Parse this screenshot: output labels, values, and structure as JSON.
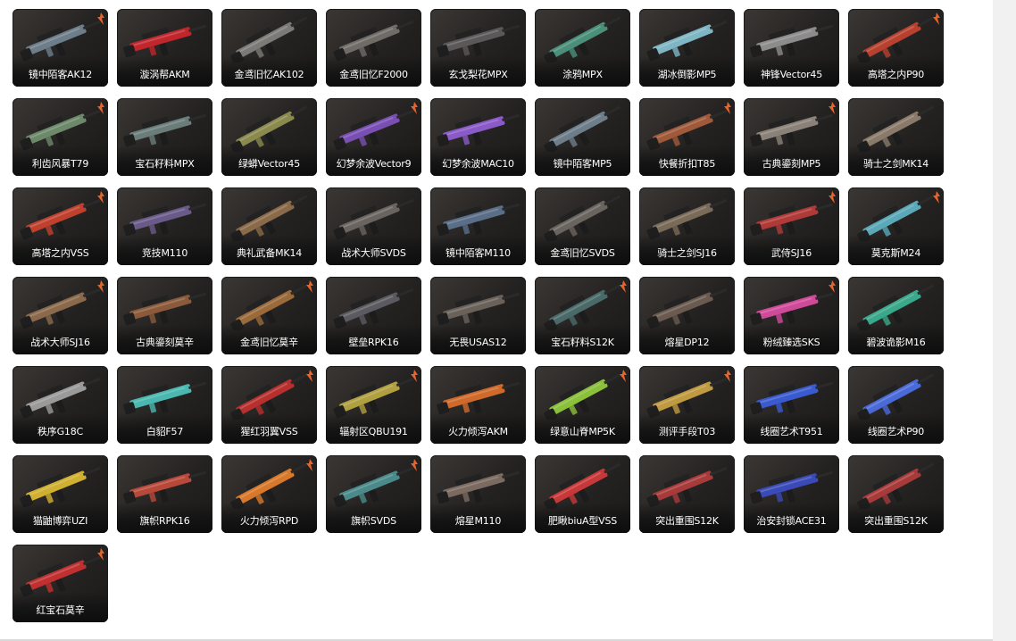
{
  "items": [
    {
      "name": "镜中陌客AK12",
      "accent": "#6d7e8a",
      "badge": true
    },
    {
      "name": "漩涡帮AKM",
      "accent": "#c0262c",
      "badge": false
    },
    {
      "name": "金鸢旧忆AK102",
      "accent": "#7c7a76",
      "badge": false
    },
    {
      "name": "金鸢旧忆F2000",
      "accent": "#6f6c68",
      "badge": false
    },
    {
      "name": "玄戈梨花MPX",
      "accent": "#5a5858",
      "badge": false
    },
    {
      "name": "涂鸦MPX",
      "accent": "#4a8f7a",
      "badge": false
    },
    {
      "name": "湖冰倒影MP5",
      "accent": "#7fb6c4",
      "badge": false
    },
    {
      "name": "神锋Vector45",
      "accent": "#8c8c8c",
      "badge": false
    },
    {
      "name": "高塔之内P90",
      "accent": "#b8402e",
      "badge": true
    },
    {
      "name": "利齿风暴T79",
      "accent": "#6c8a6a",
      "badge": true
    },
    {
      "name": "宝石籽料MPX",
      "accent": "#6a7d7a",
      "badge": false
    },
    {
      "name": "绿蟒Vector45",
      "accent": "#8a8a4e",
      "badge": false
    },
    {
      "name": "幻梦余波Vector9",
      "accent": "#7a4fb4",
      "badge": true
    },
    {
      "name": "幻梦余波MAC10",
      "accent": "#8a5ac8",
      "badge": false
    },
    {
      "name": "镜中陌客MP5",
      "accent": "#6d7e8a",
      "badge": false
    },
    {
      "name": "快餐折扣T85",
      "accent": "#a05a3a",
      "badge": true
    },
    {
      "name": "古典鎏刻MP5",
      "accent": "#8a8278",
      "badge": true
    },
    {
      "name": "骑士之剑MK14",
      "accent": "#8a7a6a",
      "badge": false
    },
    {
      "name": "高塔之内VSS",
      "accent": "#c0402e",
      "badge": true
    },
    {
      "name": "竞技M110",
      "accent": "#6a5a8a",
      "badge": false
    },
    {
      "name": "典礼武备MK14",
      "accent": "#8a6a48",
      "badge": false
    },
    {
      "name": "战术大师SVDS",
      "accent": "#6a6460",
      "badge": false
    },
    {
      "name": "镜中陌客M110",
      "accent": "#5a6e88",
      "badge": false
    },
    {
      "name": "金鸢旧忆SVDS",
      "accent": "#6a645e",
      "badge": false
    },
    {
      "name": "骑士之剑SJ16",
      "accent": "#7a6a58",
      "badge": false
    },
    {
      "name": "武侍SJ16",
      "accent": "#b03a38",
      "badge": true
    },
    {
      "name": "莫克斯M24",
      "accent": "#5aa8b8",
      "badge": true
    },
    {
      "name": "战术大师SJ16",
      "accent": "#8a6a4a",
      "badge": true
    },
    {
      "name": "古典鎏刻莫辛",
      "accent": "#8a5a3a",
      "badge": false
    },
    {
      "name": "金鸢旧忆莫辛",
      "accent": "#9a6a3a",
      "badge": true
    },
    {
      "name": "壁垒RPK16",
      "accent": "#5a5a60",
      "badge": false
    },
    {
      "name": "无畏USAS12",
      "accent": "#6a625a",
      "badge": false
    },
    {
      "name": "宝石籽料S12K",
      "accent": "#4a6a6a",
      "badge": true
    },
    {
      "name": "熔星DP12",
      "accent": "#6a5a50",
      "badge": false
    },
    {
      "name": "粉绒臻选SKS",
      "accent": "#d04a9a",
      "badge": true
    },
    {
      "name": "碧波诡影M16",
      "accent": "#3aa88a",
      "badge": false
    },
    {
      "name": "秩序G18C",
      "accent": "#9a9a9a",
      "badge": false
    },
    {
      "name": "白貂F57",
      "accent": "#4ab8b0",
      "badge": false
    },
    {
      "name": "猩红羽翼VSS",
      "accent": "#b8302e",
      "badge": true
    },
    {
      "name": "辐射区QBU191",
      "accent": "#b0a040",
      "badge": true
    },
    {
      "name": "火力倾泻AKM",
      "accent": "#d06a2a",
      "badge": false
    },
    {
      "name": "绿意山脊MP5K",
      "accent": "#8ac03a",
      "badge": true
    },
    {
      "name": "测评手段T03",
      "accent": "#c09a40",
      "badge": true
    },
    {
      "name": "线圈艺术T951",
      "accent": "#3a5ad0",
      "badge": false
    },
    {
      "name": "线圈艺术P90",
      "accent": "#4a6ad8",
      "badge": false
    },
    {
      "name": "猫鼬博弈UZI",
      "accent": "#d0b030",
      "badge": false
    },
    {
      "name": "旗帜RPK16",
      "accent": "#b8483a",
      "badge": false
    },
    {
      "name": "火力倾泻RPD",
      "accent": "#d8782a",
      "badge": true
    },
    {
      "name": "旗帜SVDS",
      "accent": "#4a8a8a",
      "badge": true
    },
    {
      "name": "熔星M110",
      "accent": "#7a6a60",
      "badge": false
    },
    {
      "name": "肥瞅biuA型VSS",
      "accent": "#c83838",
      "badge": false
    },
    {
      "name": "突出重围S12K",
      "accent": "#a83a3a",
      "badge": false
    },
    {
      "name": "治安封锁ACE31",
      "accent": "#3a4ab8",
      "badge": false
    },
    {
      "name": "突出重围S12K",
      "accent": "#a83a3a",
      "badge": false
    },
    {
      "name": "红宝石莫辛",
      "accent": "#c03030",
      "badge": true
    }
  ]
}
